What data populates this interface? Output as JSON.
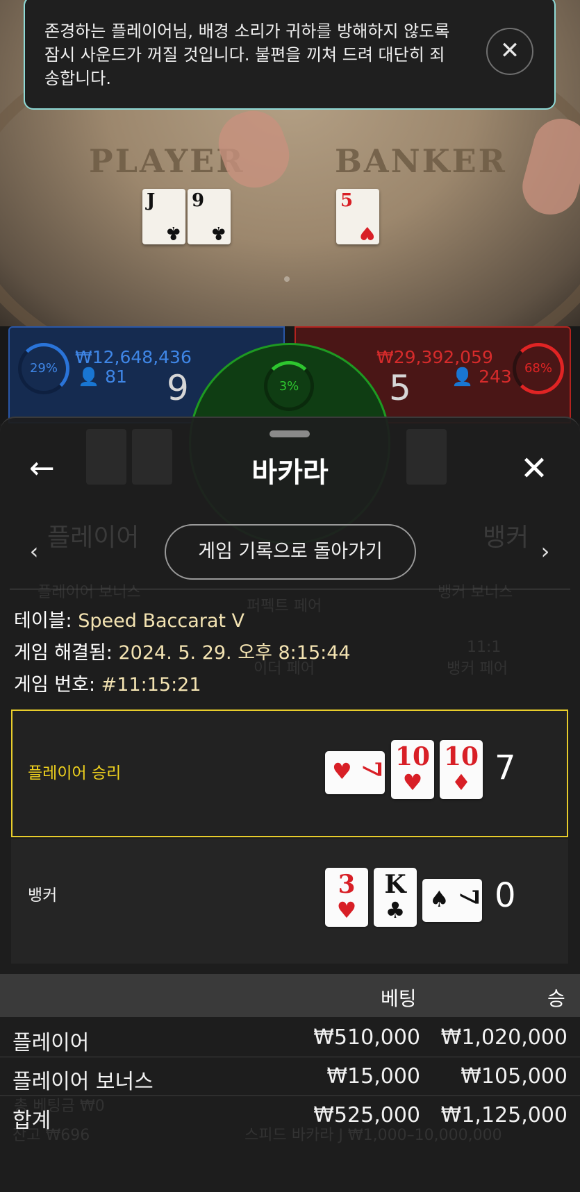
{
  "toast": {
    "message": "존경하는 플레이어님, 배경 소리가 귀하를 방해하지 않도록 잠시 사운드가 꺼질 것입니다. 불편을 끼쳐 드려 대단히 죄송합니다.",
    "close_glyph": "✕"
  },
  "video": {
    "player_label": "PLAYER",
    "banker_label": "BANKER",
    "player_cards": [
      {
        "rank": "J",
        "suit": "♣"
      },
      {
        "rank": "9",
        "suit": "♣"
      }
    ],
    "banker_cards": [
      {
        "rank": "5",
        "suit": "♥"
      }
    ]
  },
  "bets": {
    "player": {
      "percent": "29%",
      "amount": "₩12,648,436",
      "players": "81",
      "score": "9",
      "color": "#2a74d9"
    },
    "banker": {
      "percent": "68%",
      "amount": "₩29,392,059",
      "players": "243",
      "score": "5",
      "color": "#e02424"
    },
    "tie": {
      "percent": "3%",
      "color": "#2ec62f"
    }
  },
  "background_ghost": {
    "player_label": "플레이어",
    "banker_label": "뱅커",
    "player_bonus": "플레이어 보너스",
    "banker_bonus": "뱅커 보너스",
    "perfect_pair": "퍼펙트 페어",
    "either_pair": "이더 페어",
    "banker_pair": "뱅커 페어",
    "banker_pair_odds": "11:1",
    "balance": "잔고 ₩696",
    "limits": "스피드 바카라 J ₩1,000–10,000,000",
    "total_bet": "총 베팅금 ₩0"
  },
  "sheet": {
    "back_glyph": "←",
    "title": "바카라",
    "close_glyph": "✕",
    "prev_glyph": "‹",
    "next_glyph": "›",
    "history_button": "게임 기록으로 돌아가기"
  },
  "info": {
    "table_label": "테이블:",
    "table_value": "Speed Baccarat V",
    "resolved_label": "게임 해결됨:",
    "resolved_value": "2024. 5. 29. 오후 8:15:44",
    "number_label": "게임 번호:",
    "number_value": "#11:15:21"
  },
  "result": {
    "player": {
      "label": "플레이어 승리",
      "label_color": "#f0d21e",
      "cards": [
        {
          "rank": "7",
          "suit": "♥"
        },
        {
          "rank": "10",
          "suit": "♥"
        },
        {
          "rank": "10",
          "suit": "♦"
        }
      ],
      "total": "7"
    },
    "banker": {
      "label": "뱅커",
      "cards": [
        {
          "rank": "3",
          "suit": "♥"
        },
        {
          "rank": "K",
          "suit": "♣"
        },
        {
          "rank": "7",
          "suit": "♠"
        }
      ],
      "total": "0"
    }
  },
  "bet_table": {
    "headers": [
      "베팅",
      "승"
    ],
    "rows": [
      {
        "name": "플레이어",
        "bet": "₩510,000",
        "win": "₩1,020,000"
      },
      {
        "name": "플레이어 보너스",
        "bet": "₩15,000",
        "win": "₩105,000"
      },
      {
        "name": "합계",
        "bet": "₩525,000",
        "win": "₩1,125,000"
      }
    ]
  }
}
